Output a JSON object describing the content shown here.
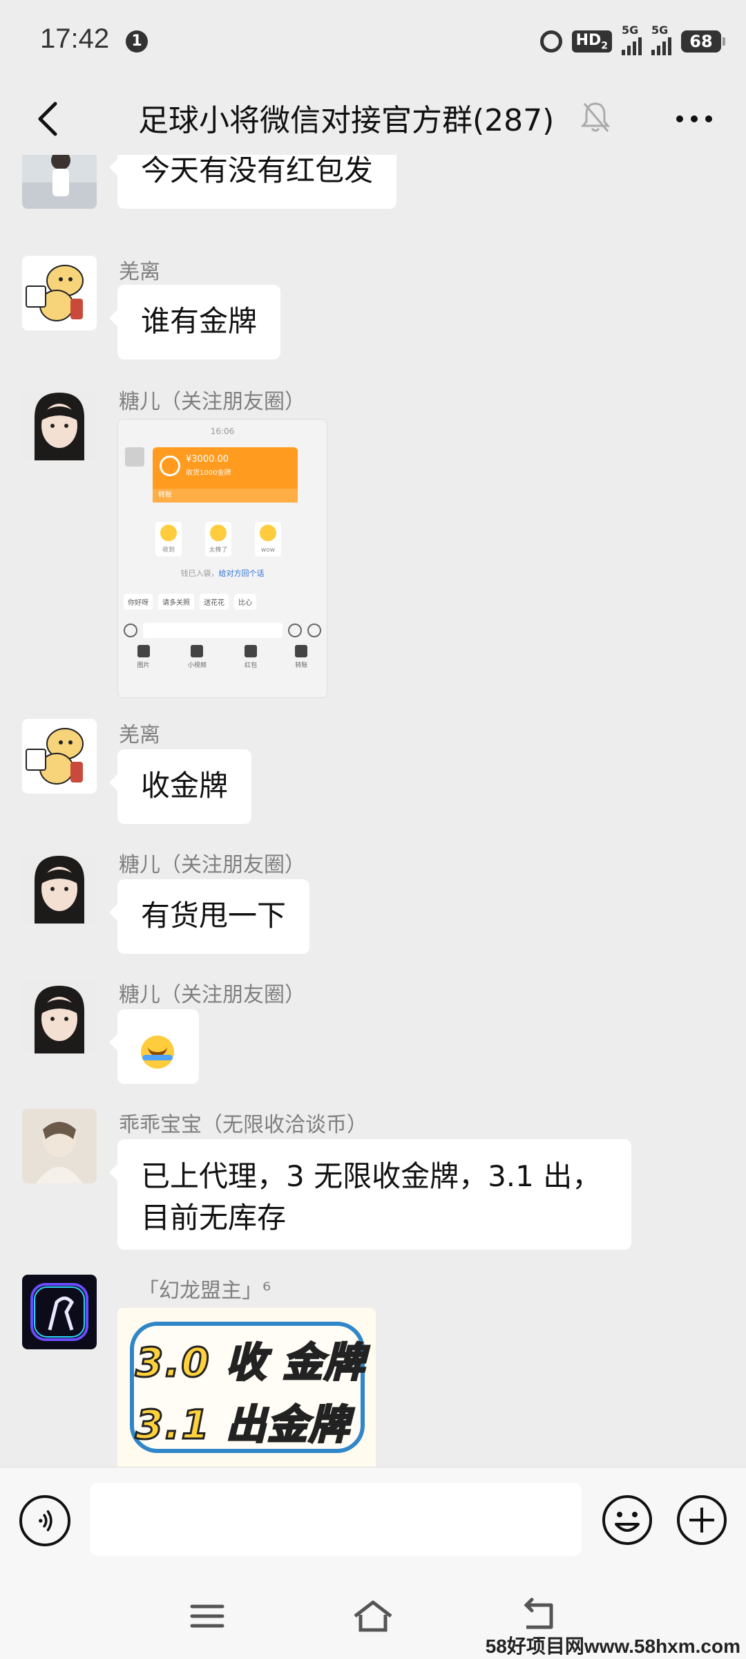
{
  "status": {
    "time": "17:42",
    "notification": "1",
    "hd": "HD",
    "hd_sub": "2",
    "net1": "5G",
    "net2": "5G",
    "battery": "68"
  },
  "header": {
    "title": "足球小将微信对接官方群(287)"
  },
  "messages": [
    {
      "type": "text",
      "sender": "",
      "text": "今天有没有红包发"
    },
    {
      "type": "text",
      "sender": "羌离",
      "text": "谁有金牌"
    },
    {
      "type": "image",
      "sender": "糖儿（关注朋友圈）",
      "screenshot": {
        "time": "16:06",
        "amount": "¥3000.00",
        "desc": "收货1000金牌",
        "card_footer": "转账",
        "reactions": [
          "收到",
          "太棒了",
          "wow"
        ],
        "note": "钱已入袋，",
        "note_link": "给对方回个话",
        "chips": [
          "你好呀",
          "请多关照",
          "送花花",
          "比心"
        ],
        "tools": [
          "图片",
          "小视频",
          "红包",
          "转账"
        ]
      }
    },
    {
      "type": "text",
      "sender": "羌离",
      "text": "收金牌"
    },
    {
      "type": "text",
      "sender": "糖儿（关注朋友圈）",
      "text": "有货甩一下"
    },
    {
      "type": "emoji",
      "sender": "糖儿（关注朋友圈）",
      "emoji": "face-with-tears-of-joy"
    },
    {
      "type": "text",
      "sender": "乖乖宝宝（无限收洽谈币）",
      "lines": [
        "已上代理，3 无限收金牌，3.1 出，",
        "目前无库存"
      ]
    },
    {
      "type": "sticker",
      "sender": "「幻龙盟主」⁶",
      "lines": [
        "3.0 收 金牌",
        "3.1 出金牌"
      ]
    }
  ],
  "input": {
    "placeholder": ""
  },
  "watermark": "58好项目网www.58hxm.com",
  "colors": {
    "background": "#ededed",
    "bubble": "#ffffff",
    "sender": "#7f7f7f"
  }
}
